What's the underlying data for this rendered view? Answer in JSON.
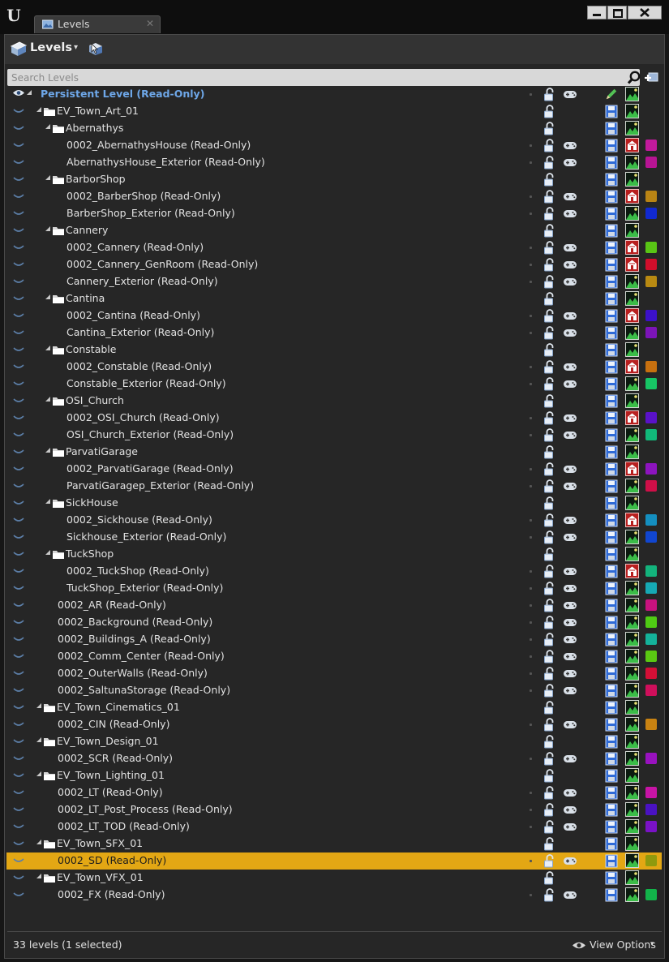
{
  "window": {
    "tab_label": "Levels",
    "tab_close": "✕",
    "logo": "U"
  },
  "toolbar": {
    "levels_label": "Levels",
    "caret": "▾"
  },
  "search": {
    "placeholder": "Search Levels"
  },
  "footer": {
    "count": "33 levels (1 selected)",
    "view_options": "View Options",
    "caret": "▾"
  },
  "rows": [
    {
      "label": "Persistent Level (Read-Only)",
      "depth": 0,
      "type": "persistent",
      "pad": true,
      "edit": true,
      "eye_open": true
    },
    {
      "label": "EV_Town_Art_01",
      "depth": 1,
      "type": "folder"
    },
    {
      "label": "Abernathys",
      "depth": 2,
      "type": "folder"
    },
    {
      "label": "0002_AbernathysHouse (Read-Only)",
      "depth": 3,
      "type": "level",
      "pad": true,
      "red_icon": true,
      "color": "#c21a9c"
    },
    {
      "label": "AbernathysHouse_Exterior (Read-Only)",
      "depth": 3,
      "type": "level",
      "pad": true,
      "color": "#b71493"
    },
    {
      "label": "BarborShop",
      "depth": 2,
      "type": "folder"
    },
    {
      "label": "0002_BarberShop (Read-Only)",
      "depth": 3,
      "type": "level",
      "pad": true,
      "red_icon": true,
      "color": "#b98414"
    },
    {
      "label": "BarberShop_Exterior (Read-Only)",
      "depth": 3,
      "type": "level",
      "pad": true,
      "color": "#1129d0"
    },
    {
      "label": "Cannery",
      "depth": 2,
      "type": "folder"
    },
    {
      "label": "0002_Cannery (Read-Only)",
      "depth": 3,
      "type": "level",
      "pad": true,
      "red_icon": true,
      "color": "#59c515"
    },
    {
      "label": "0002_Cannery_GenRoom (Read-Only)",
      "depth": 3,
      "type": "level",
      "pad": true,
      "red_icon": true,
      "color": "#d10e2b"
    },
    {
      "label": "Cannery_Exterior (Read-Only)",
      "depth": 3,
      "type": "level",
      "pad": true,
      "color": "#b98a12"
    },
    {
      "label": "Cantina",
      "depth": 2,
      "type": "folder"
    },
    {
      "label": "0002_Cantina (Read-Only)",
      "depth": 3,
      "type": "level",
      "pad": true,
      "red_icon": true,
      "color": "#3c11c9"
    },
    {
      "label": "Cantina_Exterior (Read-Only)",
      "depth": 3,
      "type": "level",
      "pad": true,
      "color": "#7c14b8"
    },
    {
      "label": "Constable",
      "depth": 2,
      "type": "folder"
    },
    {
      "label": "0002_Constable (Read-Only)",
      "depth": 3,
      "type": "level",
      "pad": true,
      "red_icon": true,
      "color": "#c7700f"
    },
    {
      "label": "Constable_Exterior (Read-Only)",
      "depth": 3,
      "type": "level",
      "pad": true,
      "color": "#17c665"
    },
    {
      "label": "OSI_Church",
      "depth": 2,
      "type": "folder"
    },
    {
      "label": "0002_OSI_Church (Read-Only)",
      "depth": 3,
      "type": "level",
      "pad": true,
      "red_icon": true,
      "color": "#5a12c9"
    },
    {
      "label": "OSI_Church_Exterior (Read-Only)",
      "depth": 3,
      "type": "level",
      "pad": true,
      "color": "#11b97a"
    },
    {
      "label": "ParvatiGarage",
      "depth": 2,
      "type": "folder"
    },
    {
      "label": "0002_ParvatiGarage (Read-Only)",
      "depth": 3,
      "type": "level",
      "pad": true,
      "red_icon": true,
      "color": "#8d14bf"
    },
    {
      "label": "ParvatiGaragep_Exterior (Read-Only)",
      "depth": 3,
      "type": "level",
      "pad": true,
      "color": "#cf0f48"
    },
    {
      "label": "SickHouse",
      "depth": 2,
      "type": "folder"
    },
    {
      "label": "0002_Sickhouse (Read-Only)",
      "depth": 3,
      "type": "level",
      "pad": true,
      "red_icon": true,
      "color": "#148fc0"
    },
    {
      "label": "Sickhouse_Exterior (Read-Only)",
      "depth": 3,
      "type": "level",
      "pad": true,
      "color": "#1146d0"
    },
    {
      "label": "TuckShop",
      "depth": 2,
      "type": "folder"
    },
    {
      "label": "0002_TuckShop (Read-Only)",
      "depth": 3,
      "type": "level",
      "pad": true,
      "red_icon": true,
      "color": "#13b37c"
    },
    {
      "label": "TuckShop_Exterior (Read-Only)",
      "depth": 3,
      "type": "level",
      "pad": true,
      "color": "#16a9b4"
    },
    {
      "label": "0002_AR (Read-Only)",
      "depth": 2,
      "type": "level",
      "pad": true,
      "color": "#c8127e"
    },
    {
      "label": "0002_Background (Read-Only)",
      "depth": 2,
      "type": "level",
      "pad": true,
      "color": "#4fcb14"
    },
    {
      "label": "0002_Buildings_A (Read-Only)",
      "depth": 2,
      "type": "level",
      "pad": true,
      "color": "#14b29a"
    },
    {
      "label": "0002_Comm_Center (Read-Only)",
      "depth": 2,
      "type": "level",
      "pad": true,
      "color": "#5ac812"
    },
    {
      "label": "0002_OuterWalls (Read-Only)",
      "depth": 2,
      "type": "level",
      "pad": true,
      "color": "#d30f36"
    },
    {
      "label": "0002_SaltunaStorage (Read-Only)",
      "depth": 2,
      "type": "level",
      "pad": true,
      "color": "#cf0f5b"
    },
    {
      "label": "EV_Town_Cinematics_01",
      "depth": 1,
      "type": "folder"
    },
    {
      "label": "0002_CIN (Read-Only)",
      "depth": 2,
      "type": "level",
      "pad": true,
      "color": "#c98312"
    },
    {
      "label": "EV_Town_Design_01",
      "depth": 1,
      "type": "folder"
    },
    {
      "label": "0002_SCR (Read-Only)",
      "depth": 2,
      "type": "level",
      "pad": true,
      "color": "#9912bf"
    },
    {
      "label": "EV_Town_Lighting_01",
      "depth": 1,
      "type": "folder"
    },
    {
      "label": "0002_LT (Read-Only)",
      "depth": 2,
      "type": "level",
      "pad": true,
      "color": "#c714a6"
    },
    {
      "label": "0002_LT_Post_Process (Read-Only)",
      "depth": 2,
      "type": "level",
      "pad": true,
      "color": "#4a12c2"
    },
    {
      "label": "0002_LT_TOD (Read-Only)",
      "depth": 2,
      "type": "level",
      "pad": true,
      "color": "#7a12c6"
    },
    {
      "label": "EV_Town_SFX_01",
      "depth": 1,
      "type": "folder"
    },
    {
      "label": "0002_SD (Read-Only)",
      "depth": 2,
      "type": "level",
      "pad": true,
      "color": "#8f9a0e",
      "selected": true
    },
    {
      "label": "EV_Town_VFX_01",
      "depth": 1,
      "type": "folder"
    },
    {
      "label": "0002_FX (Read-Only)",
      "depth": 2,
      "type": "level",
      "pad": true,
      "color": "#12b44a"
    }
  ],
  "icons": {
    "eye": "eye-icon",
    "lock": "lock-icon",
    "pad": "gamepad-icon",
    "save": "save-icon",
    "image": "level-image-icon",
    "folder": "folder-icon"
  },
  "colors": {
    "selected_row": "#e3a714",
    "persistent_label": "#6ea7e8",
    "background": "#262626"
  }
}
